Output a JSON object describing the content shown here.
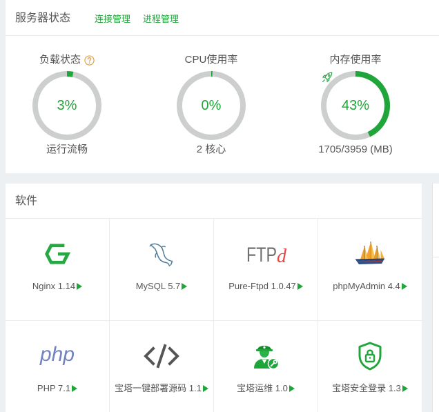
{
  "colors": {
    "accent": "#20a53a",
    "ring_track": "#cdcfce",
    "text": "#555555",
    "help": "#f0a030",
    "page_bg": "#edf0f3"
  },
  "server_status": {
    "title": "服务器状态",
    "links": [
      {
        "label": "连接管理"
      },
      {
        "label": "进程管理"
      }
    ],
    "gauges": [
      {
        "label": "负载状态",
        "help_icon": "question-circle-icon",
        "percent": 3,
        "value_text": "3%",
        "footer": "运行流畅"
      },
      {
        "label": "CPU使用率",
        "percent": 0,
        "value_text": "0%",
        "footer": "2 核心"
      },
      {
        "label": "内存使用率",
        "icon": "rocket-icon",
        "percent": 43,
        "value_text": "43%",
        "footer": "1705/3959 (MB)"
      }
    ]
  },
  "software": {
    "title": "软件",
    "arrow_icon": "triangle-right-icon",
    "items": [
      {
        "label": "Nginx 1.14",
        "icon": "nginx-icon"
      },
      {
        "label": "MySQL 5.7",
        "icon": "mysql-dolphin-icon"
      },
      {
        "label": "Pure-Ftpd 1.0.47",
        "icon": "pure-ftpd-logo",
        "logo": [
          "FTP",
          "d"
        ]
      },
      {
        "label": "phpMyAdmin 4.4",
        "icon": "phpmyadmin-sailboat-icon"
      },
      {
        "label": "PHP 7.1",
        "icon": "php-logo",
        "logo": [
          "php"
        ]
      },
      {
        "label": "宝塔一键部署源码 1.1",
        "icon": "code-brackets-icon"
      },
      {
        "label": "宝塔运维 1.0",
        "icon": "ops-engineer-icon"
      },
      {
        "label": "宝塔安全登录 1.3",
        "icon": "security-shield-lock-icon"
      }
    ]
  }
}
